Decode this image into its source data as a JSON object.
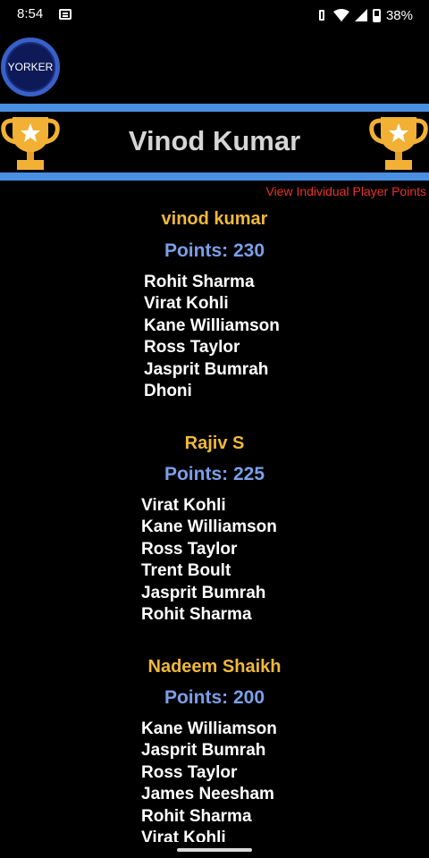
{
  "status_bar": {
    "time": "8:54",
    "battery": "38%",
    "icons": [
      "notification-icon",
      "vibrate-icon",
      "wifi-icon",
      "signal-icon",
      "battery-icon"
    ]
  },
  "logo": {
    "text": "YORKER"
  },
  "header": {
    "title": "Vinod Kumar",
    "icon": "trophy-icon"
  },
  "view_link": {
    "label": "View Individual Player Points"
  },
  "points_prefix": "Points: ",
  "entries": [
    {
      "name": "vinod kumar",
      "points": "230",
      "players": [
        "Rohit Sharma",
        "Virat Kohli",
        "Kane Williamson",
        "Ross Taylor",
        "Jasprit Bumrah",
        "Dhoni"
      ]
    },
    {
      "name": "Rajiv S",
      "points": "225",
      "players": [
        "Virat Kohli",
        "Kane Williamson",
        "Ross Taylor",
        "Trent Boult",
        "Jasprit Bumrah",
        "Rohit Sharma"
      ]
    },
    {
      "name": "Nadeem Shaikh",
      "points": "200",
      "players": [
        "Kane Williamson",
        "Jasprit Bumrah",
        "Ross Taylor",
        "James Neesham",
        "Rohit Sharma",
        "Virat Kohli"
      ]
    }
  ],
  "colors": {
    "background": "#000000",
    "accent_stripe": "#4a90e2",
    "name": "#f0b93a",
    "points": "#7b9fe8",
    "link": "#e8322d"
  }
}
